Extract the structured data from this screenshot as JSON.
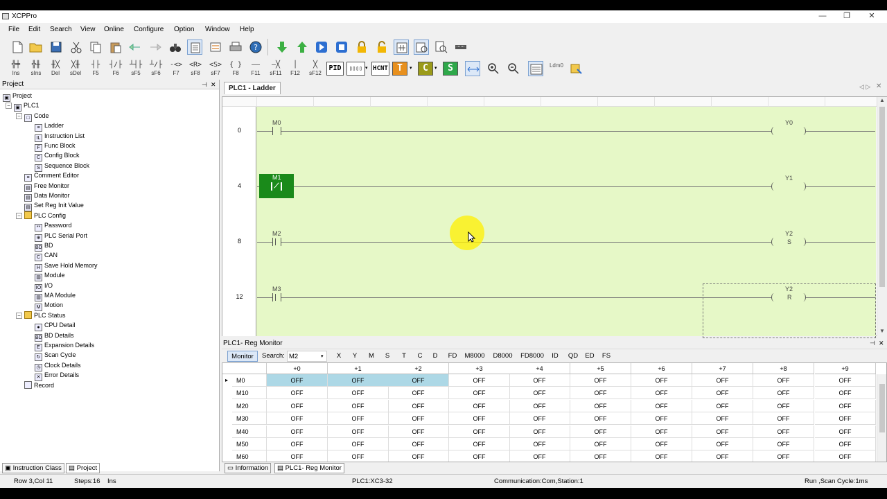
{
  "window": {
    "title": "XCPPro",
    "minimize_glyph": "—",
    "restore_glyph": "❐",
    "close_glyph": "✕"
  },
  "menu": [
    "File",
    "Edit",
    "Search",
    "View",
    "Online",
    "Configure",
    "Option",
    "Window",
    "Help"
  ],
  "toolbar2_keys": [
    "Ins",
    "sIns",
    "Del",
    "sDel",
    "F5",
    "F6",
    "sF5",
    "sF6",
    "F7",
    "sF8",
    "sF7",
    "F8",
    "F11",
    "sF11",
    "F12",
    "sF12"
  ],
  "toolbar2_buttons": {
    "pid": "PID",
    "pulse": "▯▯▯▯",
    "hcnt": "HCNT",
    "t": "T",
    "c": "C",
    "s": "S",
    "ldm": "Ldm0"
  },
  "project": {
    "title": "Project",
    "root": "Project",
    "plc": "PLC1",
    "code": {
      "label": "Code",
      "items": [
        "Ladder",
        "Instruction List",
        "Func Block",
        "Config Block",
        "Sequence Block"
      ]
    },
    "tools": [
      "Comment Editor",
      "Free Monitor",
      "Data Monitor",
      "Set Reg Init Value"
    ],
    "plc_config": {
      "label": "PLC Config",
      "items": [
        "Password",
        "PLC Serial Port",
        "BD",
        "CAN",
        "Save Hold Memory",
        "Module",
        "I/O",
        "MA Module",
        "Motion"
      ]
    },
    "plc_status": {
      "label": "PLC Status",
      "items": [
        "CPU Detail",
        "BD Details",
        "Expansion Details",
        "Scan Cycle",
        "Clock Details",
        "Error Details"
      ]
    },
    "record": "Record",
    "tabs": [
      "Instruction Class",
      "Project"
    ]
  },
  "ladder": {
    "tab": "PLC1 - Ladder",
    "rungs": [
      {
        "num": "0",
        "contact": "M0",
        "coil": "Y0",
        "coil_sym": ""
      },
      {
        "num": "4",
        "contact": "M1",
        "coil": "Y1",
        "coil_sym": ""
      },
      {
        "num": "8",
        "contact": "M2",
        "coil": "Y2",
        "coil_sym": "S"
      },
      {
        "num": "12",
        "contact": "M3",
        "coil": "Y2",
        "coil_sym": "R"
      }
    ]
  },
  "regmon": {
    "title": "PLC1- Reg Monitor",
    "monitor_btn": "Monitor",
    "search_label": "Search:",
    "search_value": "M2",
    "types": [
      "X",
      "Y",
      "M",
      "S",
      "T",
      "C",
      "D",
      "FD",
      "M8000",
      "D8000",
      "FD8000",
      "ID",
      "QD",
      "ED",
      "FS"
    ],
    "columns": [
      "+0",
      "+1",
      "+2",
      "+3",
      "+4",
      "+5",
      "+6",
      "+7",
      "+8",
      "+9"
    ],
    "rows": [
      {
        "addr": "M0",
        "vals": [
          "OFF",
          "OFF",
          "OFF",
          "OFF",
          "OFF",
          "OFF",
          "OFF",
          "OFF",
          "OFF",
          "OFF"
        ]
      },
      {
        "addr": "M10",
        "vals": [
          "OFF",
          "OFF",
          "OFF",
          "OFF",
          "OFF",
          "OFF",
          "OFF",
          "OFF",
          "OFF",
          "OFF"
        ]
      },
      {
        "addr": "M20",
        "vals": [
          "OFF",
          "OFF",
          "OFF",
          "OFF",
          "OFF",
          "OFF",
          "OFF",
          "OFF",
          "OFF",
          "OFF"
        ]
      },
      {
        "addr": "M30",
        "vals": [
          "OFF",
          "OFF",
          "OFF",
          "OFF",
          "OFF",
          "OFF",
          "OFF",
          "OFF",
          "OFF",
          "OFF"
        ]
      },
      {
        "addr": "M40",
        "vals": [
          "OFF",
          "OFF",
          "OFF",
          "OFF",
          "OFF",
          "OFF",
          "OFF",
          "OFF",
          "OFF",
          "OFF"
        ]
      },
      {
        "addr": "M50",
        "vals": [
          "OFF",
          "OFF",
          "OFF",
          "OFF",
          "OFF",
          "OFF",
          "OFF",
          "OFF",
          "OFF",
          "OFF"
        ]
      },
      {
        "addr": "M60",
        "vals": [
          "OFF",
          "OFF",
          "OFF",
          "OFF",
          "OFF",
          "OFF",
          "OFF",
          "OFF",
          "OFF",
          "OFF"
        ]
      }
    ],
    "bottom_tabs": [
      "Information",
      "PLC1- Reg Monitor"
    ]
  },
  "status": {
    "rowcol": "Row 3,Col 11",
    "steps": "Steps:16",
    "mode": "Ins",
    "plc": "PLC1:XC3-32",
    "comm": "Communication:Com,Station:1",
    "run": "Run ,Scan Cycle:1ms"
  },
  "colors": {
    "ladder_bg": "#e6f8c7",
    "selected_contact": "#1a8a1a",
    "cursor_highlight": "#ffff00",
    "selected_cell": "#add8e6"
  }
}
